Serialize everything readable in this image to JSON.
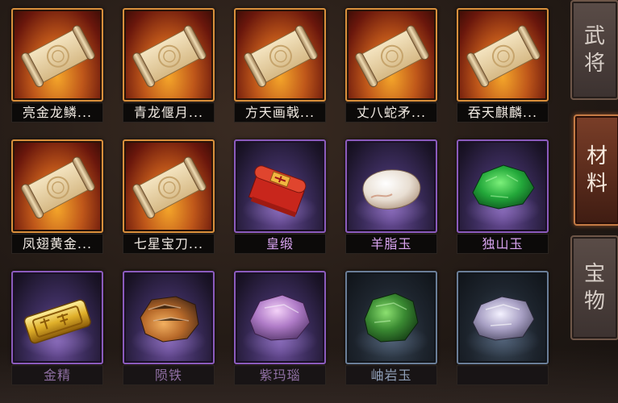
{
  "grid": {
    "items": [
      {
        "name": "亮金龙鳞...",
        "tier": "orange",
        "icon": "scroll-icon"
      },
      {
        "name": "青龙偃月...",
        "tier": "orange",
        "icon": "scroll-icon"
      },
      {
        "name": "方天画戟...",
        "tier": "orange",
        "icon": "scroll-icon"
      },
      {
        "name": "丈八蛇矛...",
        "tier": "orange",
        "icon": "scroll-icon"
      },
      {
        "name": "吞天麒麟...",
        "tier": "orange",
        "icon": "scroll-icon"
      },
      {
        "name": "凤翅黄金...",
        "tier": "orange",
        "icon": "scroll-icon"
      },
      {
        "name": "七星宝刀...",
        "tier": "orange",
        "icon": "scroll-icon"
      },
      {
        "name": "皇缎",
        "tier": "purple",
        "icon": "red-silk-icon"
      },
      {
        "name": "羊脂玉",
        "tier": "purple",
        "icon": "white-jade-icon"
      },
      {
        "name": "独山玉",
        "tier": "purple",
        "icon": "green-jade-icon"
      },
      {
        "name": "金精",
        "tier": "purple",
        "icon": "gold-ingot-icon"
      },
      {
        "name": "陨铁",
        "tier": "purple",
        "icon": "meteorite-icon"
      },
      {
        "name": "紫玛瑙",
        "tier": "purple",
        "icon": "purple-agate-icon"
      },
      {
        "name": "岫岩玉",
        "tier": "blue",
        "icon": "xiuyan-jade-icon"
      },
      {
        "name": "",
        "tier": "blue",
        "icon": "crystal-ore-icon"
      }
    ]
  },
  "tabs": [
    {
      "label_1": "武",
      "label_2": "将",
      "active": false
    },
    {
      "label_1": "材",
      "label_2": "料",
      "active": true
    },
    {
      "label_1": "宝",
      "label_2": "物",
      "active": false
    }
  ],
  "colors": {
    "orange_border": "#d9903c",
    "purple_border": "#8b5bbd",
    "blue_border": "#6a7e98",
    "active_tab": "#c47b45"
  }
}
